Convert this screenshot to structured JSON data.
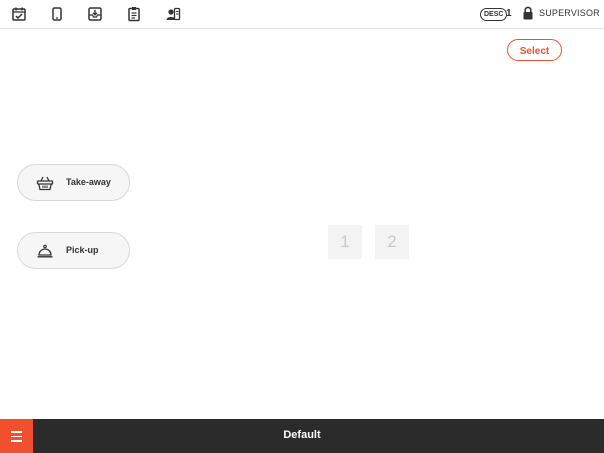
{
  "topbar": {
    "icons": [
      "calendar-check-icon",
      "tablet-icon",
      "inbox-download-icon",
      "clipboard-list-icon",
      "user-card-icon"
    ],
    "desc_badge": "DESC",
    "desc_count": "1",
    "role": "SUPERVISOR"
  },
  "actions": {
    "select_label": "Select"
  },
  "order_modes": [
    {
      "label": "Take-away",
      "icon": "shopping-basket-icon"
    },
    {
      "label": "Pick-up",
      "icon": "service-bell-icon"
    }
  ],
  "tables": [
    "1",
    "2"
  ],
  "bottombar": {
    "title": "Default",
    "menu_icon": "hamburger-menu-icon"
  },
  "colors": {
    "accent": "#f0502e",
    "bottombar": "#2b2b2b"
  }
}
